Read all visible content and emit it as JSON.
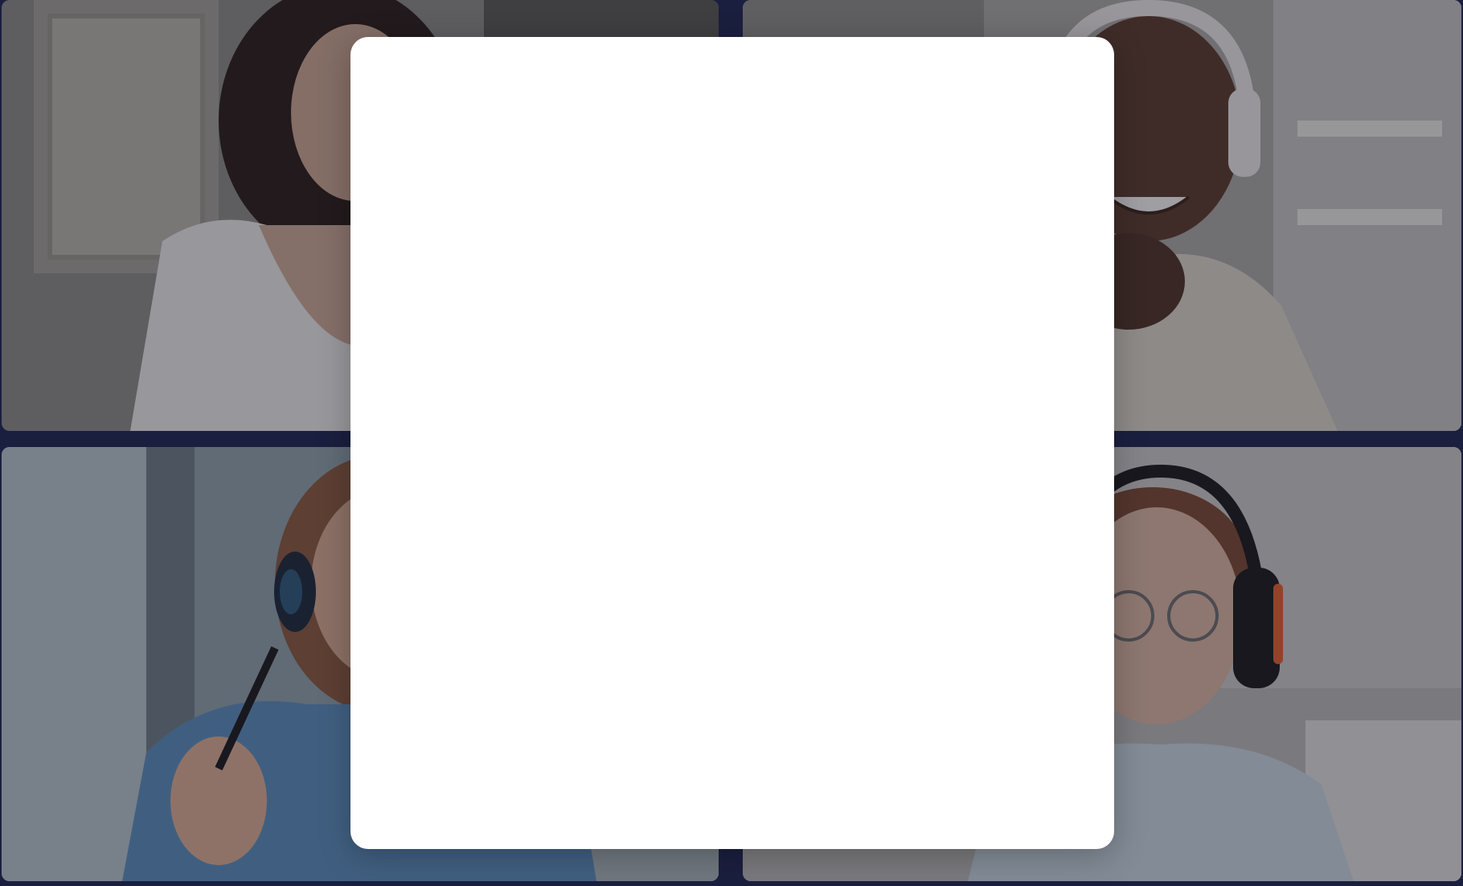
{
  "call": {
    "participants": [
      {
        "position": "top-left",
        "role": "participant-video",
        "palette": {
          "bg": "#8c8a84",
          "shirt": "#e9e7e4",
          "hair": "#2b1d17",
          "skin": "#c9a58f"
        }
      },
      {
        "position": "top-right",
        "role": "participant-video",
        "palette": {
          "bg": "#a8a6a2",
          "shirt": "#d9d2c6",
          "headphones": "#e8e6e3",
          "skin": "#5a3a2a"
        }
      },
      {
        "position": "bottom-left",
        "role": "participant-video",
        "palette": {
          "bg": "#8fa0a8",
          "shirt": "#5b8db8",
          "headphones": "#1d2a3a",
          "skin": "#d6a98f"
        }
      },
      {
        "position": "bottom-right",
        "role": "participant-video",
        "palette": {
          "bg": "#b9b7b4",
          "shirt": "#c6d3db",
          "headphones": "#1a1a1a",
          "accent": "#e0602e",
          "skin": "#d7b39e"
        }
      }
    ]
  },
  "modal": {
    "state": "open",
    "background": "#ffffff"
  },
  "colors": {
    "frame": "#1b1f3f",
    "overlay": "rgba(20,22,38,0.38)"
  }
}
